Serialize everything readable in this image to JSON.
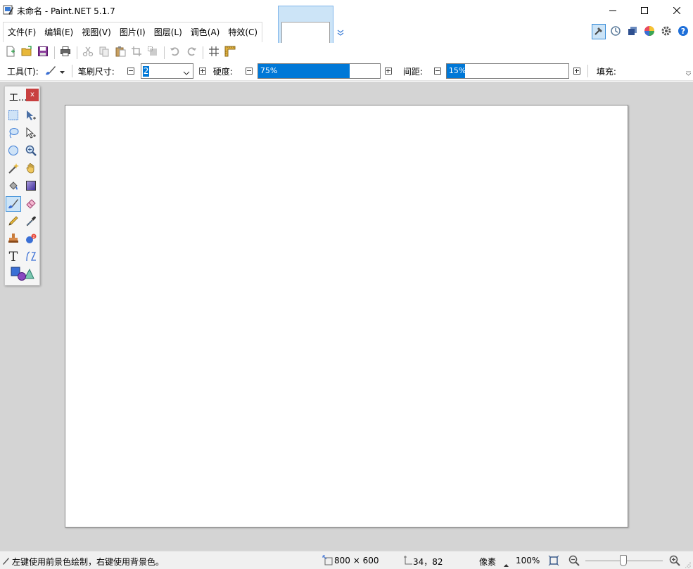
{
  "window": {
    "title": "未命名 - Paint.NET 5.1.7"
  },
  "menu": {
    "items": [
      "文件(F)",
      "编辑(E)",
      "视图(V)",
      "图片(I)",
      "图层(L)",
      "调色(A)",
      "特效(C)"
    ]
  },
  "right_toolbar": {
    "icons": [
      "tools-icon",
      "history-icon",
      "layers-icon",
      "colors-icon",
      "settings-icon",
      "help-icon"
    ]
  },
  "toolbar": {
    "icons": [
      "new-image-icon",
      "open-icon",
      "save-icon",
      "print-icon",
      "cut-icon",
      "copy-icon",
      "paste-icon",
      "crop-icon",
      "deselect-icon",
      "undo-icon",
      "redo-icon",
      "grid-icon",
      "ruler-icon"
    ]
  },
  "options": {
    "tool_label": "工具(T):",
    "brush_size_label": "笔刷尺寸:",
    "brush_size_value": "2",
    "hardness_label": "硬度:",
    "hardness_value": "75%",
    "hardness_fraction": 0.75,
    "spacing_label": "间距:",
    "spacing_value": "15%",
    "spacing_fraction": 0.15,
    "fill_label": "填充:"
  },
  "tools_panel": {
    "title": "工...",
    "close": "x",
    "active_tool": "paintbrush-tool",
    "tools": [
      "rectangle-select-tool",
      "move-selection-tool",
      "lasso-select-tool",
      "move-selected-tool",
      "ellipse-select-tool",
      "zoom-tool",
      "magic-wand-tool",
      "pan-tool",
      "paint-bucket-tool",
      "gradient-tool",
      "paintbrush-tool",
      "eraser-tool",
      "pencil-tool",
      "color-picker-tool",
      "clone-stamp-tool",
      "recolor-tool",
      "text-tool",
      "line-curve-tool",
      "shapes-tool"
    ]
  },
  "status": {
    "hint": "左键使用前景色绘制，右键使用背景色。",
    "image_size": "800 × 600",
    "cursor_pos": "34，82",
    "units": "像素",
    "zoom": "100%"
  },
  "colors": {
    "accent": "#0078d7",
    "workspace": "#d4d4d4",
    "close_button": "#c84040"
  }
}
